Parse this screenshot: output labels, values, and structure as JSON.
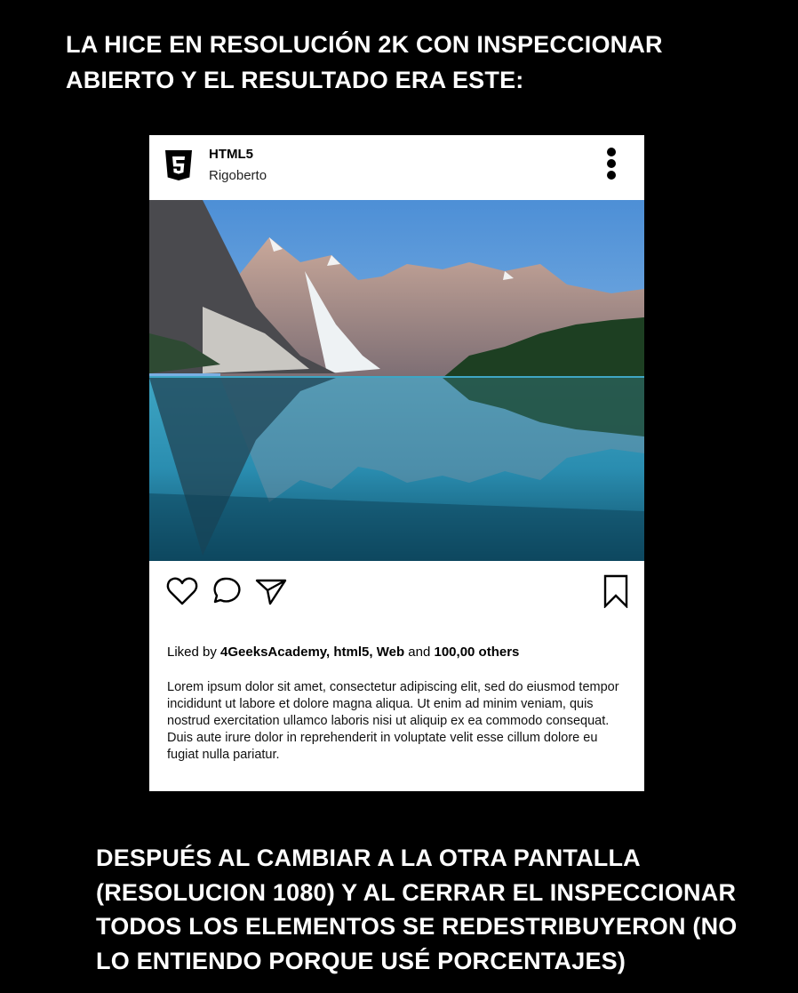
{
  "captions": {
    "top": "LA HICE EN RESOLUCIÓN 2K CON INSPECCIONAR ABIERTO Y EL RESULTADO ERA ESTE:",
    "bottom": "DESPUÉS AL CAMBIAR A LA OTRA PANTALLA (RESOLUCION 1080) Y AL CERRAR EL INSPECCIONAR TODOS LOS ELEMENTOS SE REDESTRIBUYERON (NO LO ENTIENDO PORQUE USÉ PORCENTAJES)"
  },
  "post": {
    "account_name": "HTML5",
    "account_subtitle": "Rigoberto",
    "logo_icon": "html5-logo",
    "more_icon": "more-vertical-icon",
    "image_subject": "mountain-lake-photo",
    "actions": {
      "like_icon": "heart-icon",
      "comment_icon": "comment-icon",
      "share_icon": "send-icon",
      "bookmark_icon": "bookmark-icon"
    },
    "likes": {
      "prefix": "Liked by ",
      "user1": "4GeeksAcademy,",
      "user2": "html5,",
      "user3": "Web",
      "and": " and ",
      "count": "100,00 others"
    },
    "description": "Lorem ipsum dolor sit amet, consectetur adipiscing elit, sed do eiusmod tempor incididunt ut labore et dolore magna aliqua. Ut enim ad minim veniam, quis nostrud exercitation ullamco laboris nisi ut aliquip ex ea commodo consequat. Duis aute irure dolor in reprehenderit in voluptate velit esse cillum dolore eu fugiat nulla pariatur."
  },
  "colors": {
    "background": "#000000",
    "card": "#ffffff",
    "text": "#000000"
  }
}
